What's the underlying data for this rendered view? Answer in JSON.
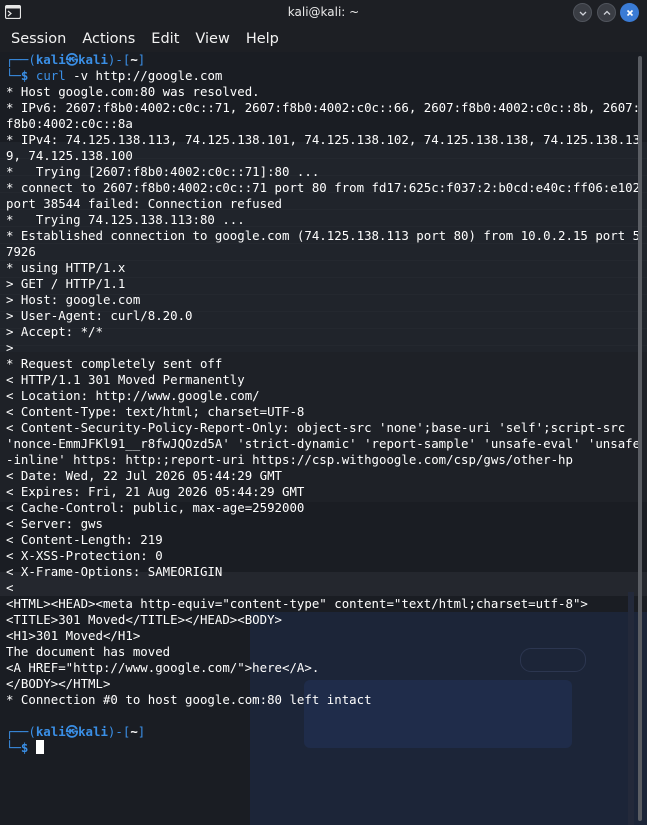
{
  "window": {
    "title": "kali@kali: ~",
    "app_icon": "terminal-icon",
    "buttons": [
      "minimize-icon",
      "maximize-icon",
      "close-icon"
    ],
    "accent_color": "#3a7bd5"
  },
  "menu": [
    "Session",
    "Actions",
    "Edit",
    "View",
    "Help"
  ],
  "prompt": {
    "user": "kali",
    "at": "㉿",
    "host": "kali",
    "path": "~",
    "symbol": "$",
    "color": "#3a8fe6"
  },
  "command": {
    "name": "curl",
    "args": " -v http://google.com"
  },
  "output_lines": [
    "* Host google.com:80 was resolved.",
    "* IPv6: 2607:f8b0:4002:c0c::71, 2607:f8b0:4002:c0c::66, 2607:f8b0:4002:c0c::8b, 2607:f8b0:4002:c0c::8a",
    "* IPv4: 74.125.138.113, 74.125.138.101, 74.125.138.102, 74.125.138.138, 74.125.138.139, 74.125.138.100",
    "*   Trying [2607:f8b0:4002:c0c::71]:80 ...",
    "* connect to 2607:f8b0:4002:c0c::71 port 80 from fd17:625c:f037:2:b0cd:e40c:ff06:e102 port 38544 failed: Connection refused",
    "*   Trying 74.125.138.113:80 ...",
    "* Established connection to google.com (74.125.138.113 port 80) from 10.0.2.15 port 57926",
    "* using HTTP/1.x",
    "> GET / HTTP/1.1",
    "> Host: google.com",
    "> User-Agent: curl/8.20.0",
    "> Accept: */*",
    ">",
    "* Request completely sent off",
    "< HTTP/1.1 301 Moved Permanently",
    "< Location: http://www.google.com/",
    "< Content-Type: text/html; charset=UTF-8",
    "< Content-Security-Policy-Report-Only: object-src 'none';base-uri 'self';script-src 'nonce-EmmJFKl91__r8fwJQOzd5A' 'strict-dynamic' 'report-sample' 'unsafe-eval' 'unsafe-inline' https: http:;report-uri https://csp.withgoogle.com/csp/gws/other-hp",
    "< Date: Wed, 22 Jul 2026 05:44:29 GMT",
    "< Expires: Fri, 21 Aug 2026 05:44:29 GMT",
    "< Cache-Control: public, max-age=2592000",
    "< Server: gws",
    "< Content-Length: 219",
    "< X-XSS-Protection: 0",
    "< X-Frame-Options: SAMEORIGIN",
    "<",
    "<HTML><HEAD><meta http-equiv=\"content-type\" content=\"text/html;charset=utf-8\">",
    "<TITLE>301 Moved</TITLE></HEAD><BODY>",
    "<H1>301 Moved</H1>",
    "The document has moved",
    "<A HREF=\"http://www.google.com/\">here</A>.",
    "</BODY></HTML>",
    "* Connection #0 to host google.com:80 left intact",
    ""
  ]
}
